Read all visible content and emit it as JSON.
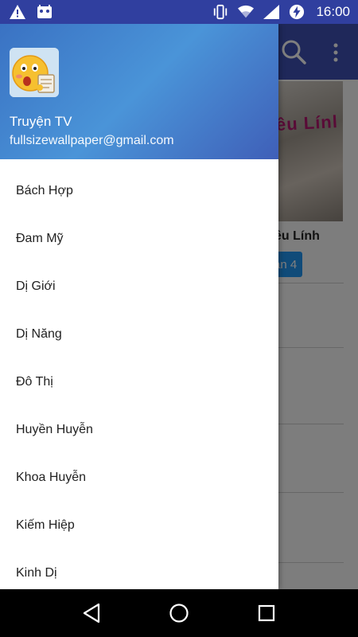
{
  "drawer": {
    "user_name": "Truyện TV",
    "user_email": "fullsizewallpaper@gmail.com",
    "avatar_icon": "emoji-avatar-icon",
    "items": [
      {
        "label": "Bách Hợp"
      },
      {
        "label": "Đam Mỹ"
      },
      {
        "label": "Dị Giới"
      },
      {
        "label": "Dị Năng"
      },
      {
        "label": "Đô Thị"
      },
      {
        "label": "Huyền Huyễn"
      },
      {
        "label": "Khoa Huyễn"
      },
      {
        "label": "Kiếm Hiệp"
      },
      {
        "label": "Kinh Dị"
      }
    ]
  },
  "statusbar": {
    "time": "16:00",
    "icons": [
      "warning-icon",
      "android-icon",
      "vibrate-icon",
      "wifi-icon",
      "signal-icon",
      "battery-charging-icon"
    ]
  },
  "background": {
    "card_title": "ều Lính",
    "card_image_text": "ều Línl",
    "card_badge": "an 4"
  },
  "colors": {
    "statusbar": "#303f9f",
    "appbar": "#3f51b5",
    "badge": "#2196f3"
  },
  "navbar": {
    "icons": [
      "back-icon",
      "home-icon",
      "recents-icon"
    ]
  }
}
